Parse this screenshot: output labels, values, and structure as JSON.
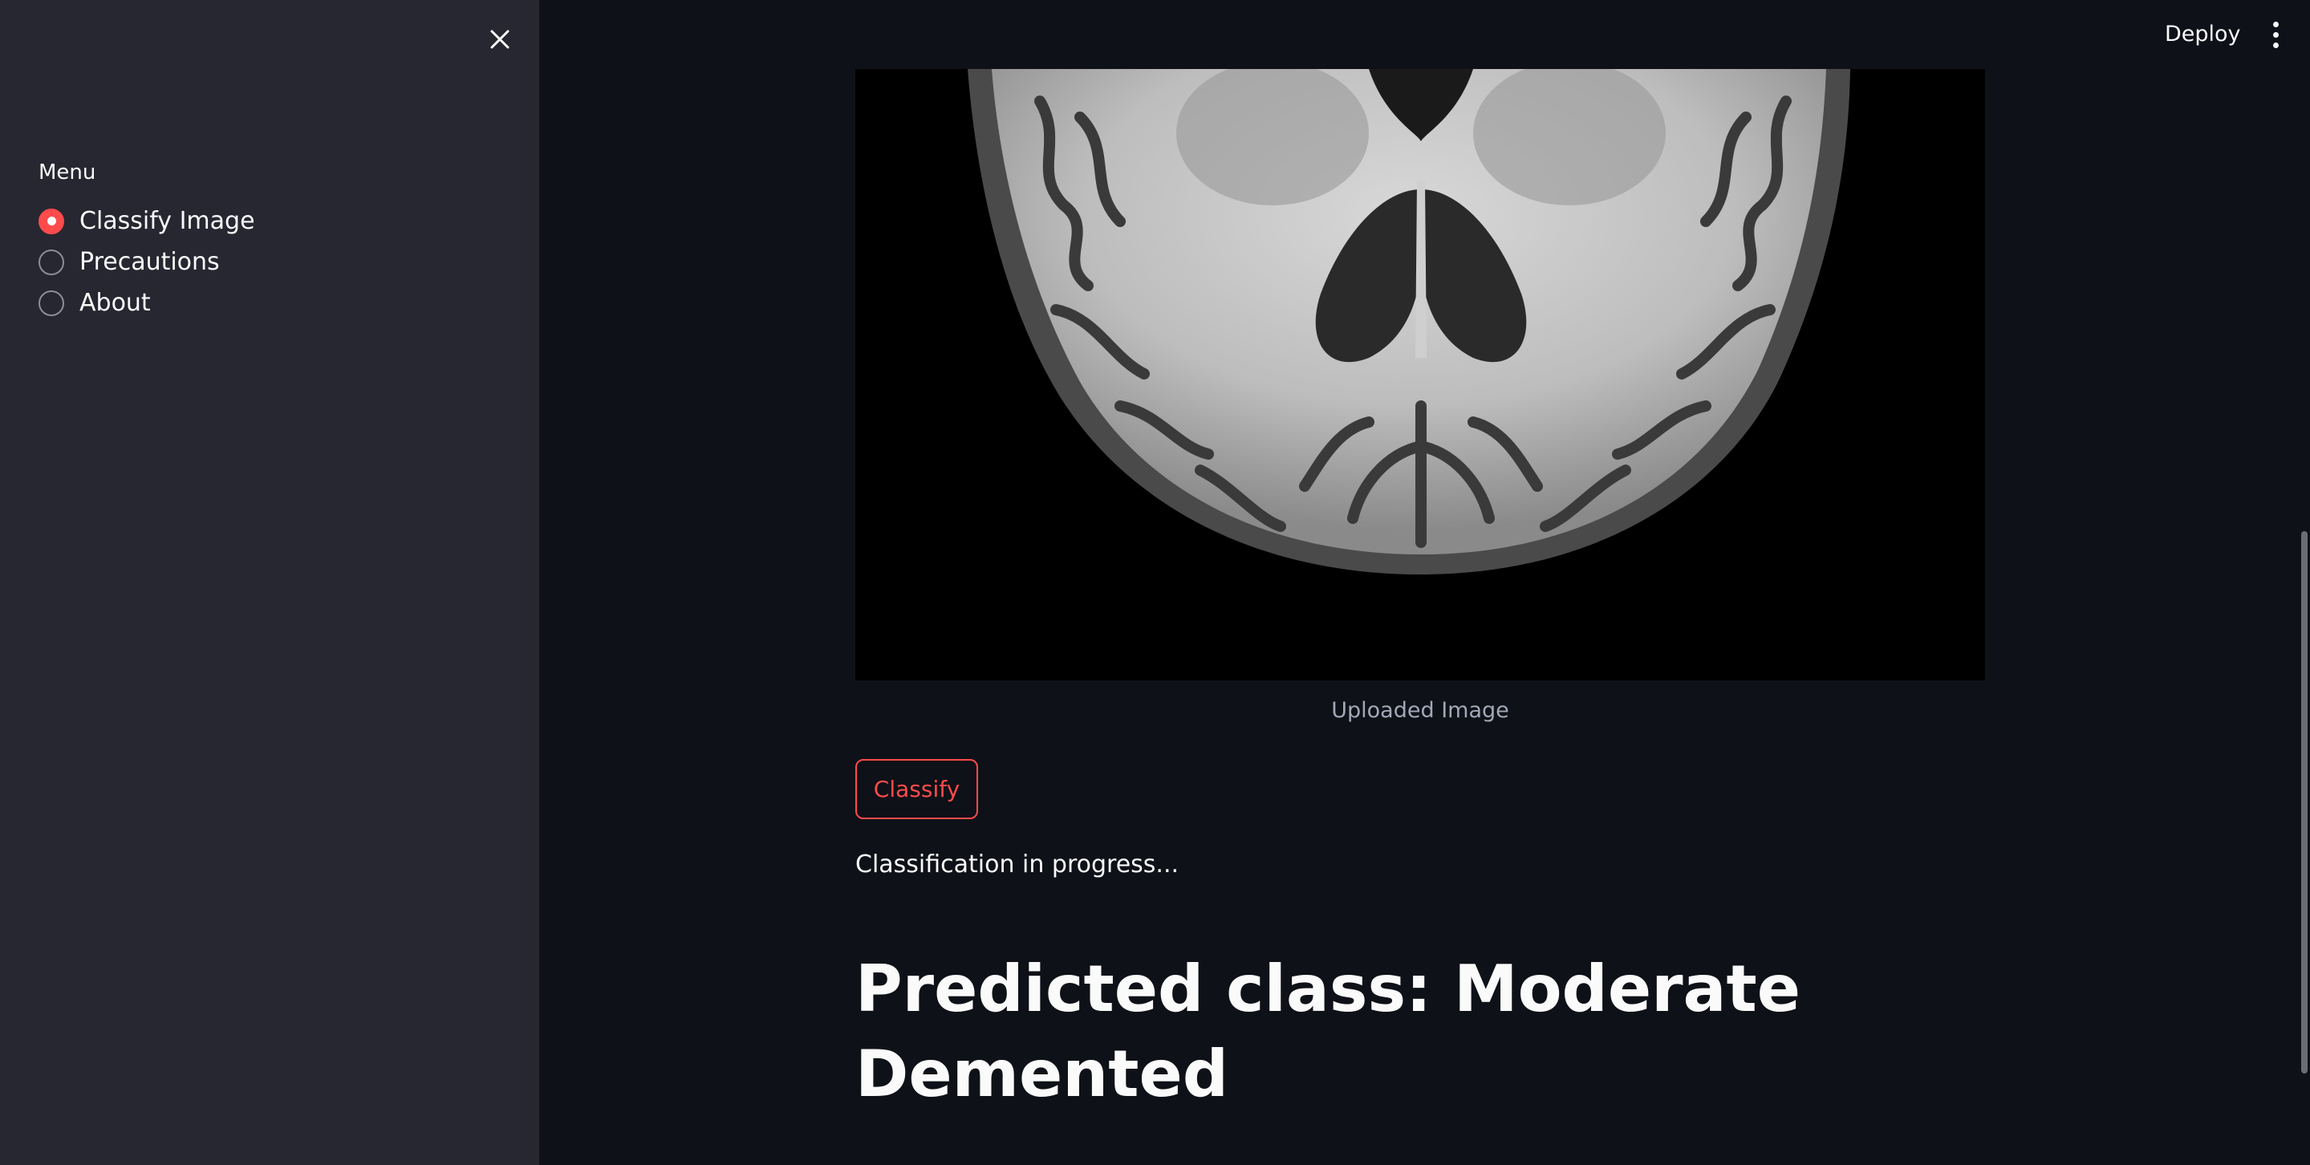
{
  "header": {
    "deploy_label": "Deploy",
    "menu_icon": "more-vertical-icon"
  },
  "sidebar": {
    "close_icon": "close-icon",
    "menu_label": "Menu",
    "items": [
      {
        "label": "Classify Image",
        "selected": true
      },
      {
        "label": "Precautions",
        "selected": false
      },
      {
        "label": "About",
        "selected": false
      }
    ]
  },
  "main": {
    "image_caption": "Uploaded Image",
    "classify_label": "Classify",
    "status_text": "Classification in progress...",
    "result_text": "Predicted class: Moderate Demented"
  },
  "colors": {
    "accent": "#ff4b4b",
    "background": "#0e1117",
    "sidebar": "#262730"
  }
}
